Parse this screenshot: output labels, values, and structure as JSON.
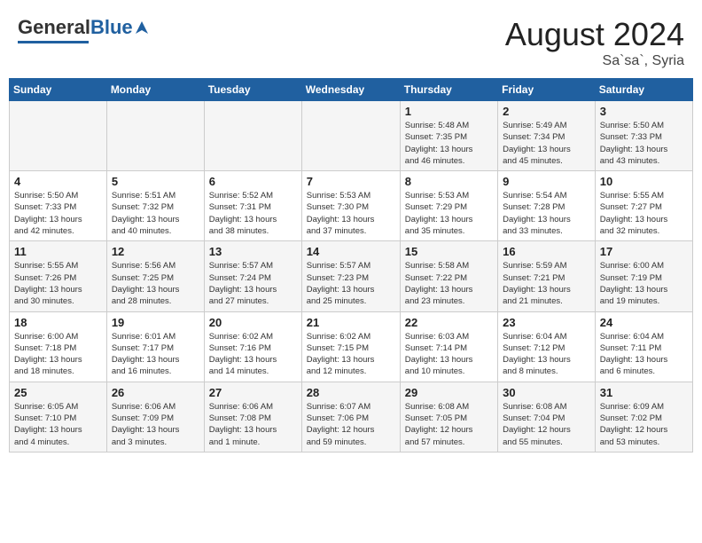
{
  "header": {
    "logo_general": "General",
    "logo_blue": "Blue",
    "month_year": "August 2024",
    "location": "Sa`sa`, Syria"
  },
  "weekdays": [
    "Sunday",
    "Monday",
    "Tuesday",
    "Wednesday",
    "Thursday",
    "Friday",
    "Saturday"
  ],
  "weeks": [
    [
      {
        "day": "",
        "info": ""
      },
      {
        "day": "",
        "info": ""
      },
      {
        "day": "",
        "info": ""
      },
      {
        "day": "",
        "info": ""
      },
      {
        "day": "1",
        "info": "Sunrise: 5:48 AM\nSunset: 7:35 PM\nDaylight: 13 hours\nand 46 minutes."
      },
      {
        "day": "2",
        "info": "Sunrise: 5:49 AM\nSunset: 7:34 PM\nDaylight: 13 hours\nand 45 minutes."
      },
      {
        "day": "3",
        "info": "Sunrise: 5:50 AM\nSunset: 7:33 PM\nDaylight: 13 hours\nand 43 minutes."
      }
    ],
    [
      {
        "day": "4",
        "info": "Sunrise: 5:50 AM\nSunset: 7:33 PM\nDaylight: 13 hours\nand 42 minutes."
      },
      {
        "day": "5",
        "info": "Sunrise: 5:51 AM\nSunset: 7:32 PM\nDaylight: 13 hours\nand 40 minutes."
      },
      {
        "day": "6",
        "info": "Sunrise: 5:52 AM\nSunset: 7:31 PM\nDaylight: 13 hours\nand 38 minutes."
      },
      {
        "day": "7",
        "info": "Sunrise: 5:53 AM\nSunset: 7:30 PM\nDaylight: 13 hours\nand 37 minutes."
      },
      {
        "day": "8",
        "info": "Sunrise: 5:53 AM\nSunset: 7:29 PM\nDaylight: 13 hours\nand 35 minutes."
      },
      {
        "day": "9",
        "info": "Sunrise: 5:54 AM\nSunset: 7:28 PM\nDaylight: 13 hours\nand 33 minutes."
      },
      {
        "day": "10",
        "info": "Sunrise: 5:55 AM\nSunset: 7:27 PM\nDaylight: 13 hours\nand 32 minutes."
      }
    ],
    [
      {
        "day": "11",
        "info": "Sunrise: 5:55 AM\nSunset: 7:26 PM\nDaylight: 13 hours\nand 30 minutes."
      },
      {
        "day": "12",
        "info": "Sunrise: 5:56 AM\nSunset: 7:25 PM\nDaylight: 13 hours\nand 28 minutes."
      },
      {
        "day": "13",
        "info": "Sunrise: 5:57 AM\nSunset: 7:24 PM\nDaylight: 13 hours\nand 27 minutes."
      },
      {
        "day": "14",
        "info": "Sunrise: 5:57 AM\nSunset: 7:23 PM\nDaylight: 13 hours\nand 25 minutes."
      },
      {
        "day": "15",
        "info": "Sunrise: 5:58 AM\nSunset: 7:22 PM\nDaylight: 13 hours\nand 23 minutes."
      },
      {
        "day": "16",
        "info": "Sunrise: 5:59 AM\nSunset: 7:21 PM\nDaylight: 13 hours\nand 21 minutes."
      },
      {
        "day": "17",
        "info": "Sunrise: 6:00 AM\nSunset: 7:19 PM\nDaylight: 13 hours\nand 19 minutes."
      }
    ],
    [
      {
        "day": "18",
        "info": "Sunrise: 6:00 AM\nSunset: 7:18 PM\nDaylight: 13 hours\nand 18 minutes."
      },
      {
        "day": "19",
        "info": "Sunrise: 6:01 AM\nSunset: 7:17 PM\nDaylight: 13 hours\nand 16 minutes."
      },
      {
        "day": "20",
        "info": "Sunrise: 6:02 AM\nSunset: 7:16 PM\nDaylight: 13 hours\nand 14 minutes."
      },
      {
        "day": "21",
        "info": "Sunrise: 6:02 AM\nSunset: 7:15 PM\nDaylight: 13 hours\nand 12 minutes."
      },
      {
        "day": "22",
        "info": "Sunrise: 6:03 AM\nSunset: 7:14 PM\nDaylight: 13 hours\nand 10 minutes."
      },
      {
        "day": "23",
        "info": "Sunrise: 6:04 AM\nSunset: 7:12 PM\nDaylight: 13 hours\nand 8 minutes."
      },
      {
        "day": "24",
        "info": "Sunrise: 6:04 AM\nSunset: 7:11 PM\nDaylight: 13 hours\nand 6 minutes."
      }
    ],
    [
      {
        "day": "25",
        "info": "Sunrise: 6:05 AM\nSunset: 7:10 PM\nDaylight: 13 hours\nand 4 minutes."
      },
      {
        "day": "26",
        "info": "Sunrise: 6:06 AM\nSunset: 7:09 PM\nDaylight: 13 hours\nand 3 minutes."
      },
      {
        "day": "27",
        "info": "Sunrise: 6:06 AM\nSunset: 7:08 PM\nDaylight: 13 hours\nand 1 minute."
      },
      {
        "day": "28",
        "info": "Sunrise: 6:07 AM\nSunset: 7:06 PM\nDaylight: 12 hours\nand 59 minutes."
      },
      {
        "day": "29",
        "info": "Sunrise: 6:08 AM\nSunset: 7:05 PM\nDaylight: 12 hours\nand 57 minutes."
      },
      {
        "day": "30",
        "info": "Sunrise: 6:08 AM\nSunset: 7:04 PM\nDaylight: 12 hours\nand 55 minutes."
      },
      {
        "day": "31",
        "info": "Sunrise: 6:09 AM\nSunset: 7:02 PM\nDaylight: 12 hours\nand 53 minutes."
      }
    ]
  ]
}
